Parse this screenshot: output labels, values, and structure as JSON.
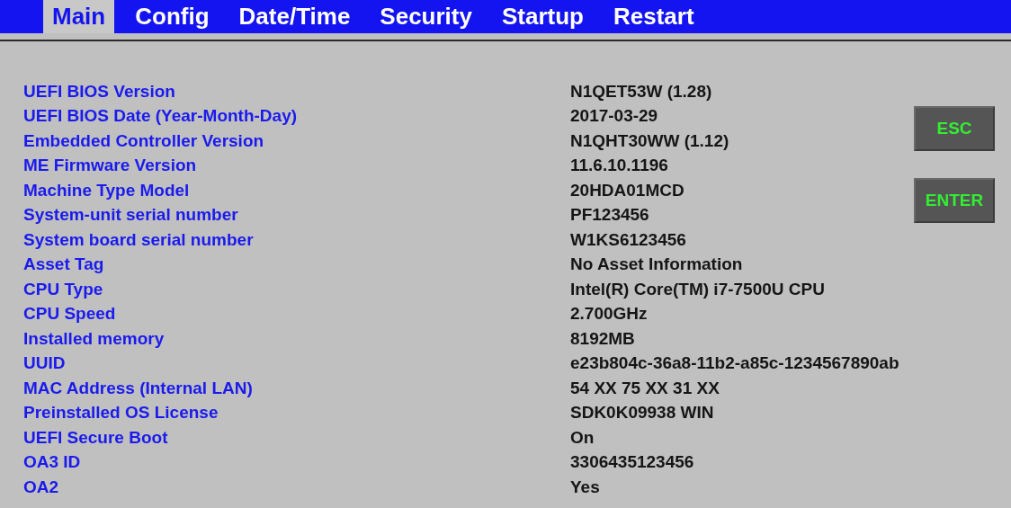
{
  "tabs": [
    {
      "label": "Main",
      "selected": true
    },
    {
      "label": "Config",
      "selected": false
    },
    {
      "label": "Date/Time",
      "selected": false
    },
    {
      "label": "Security",
      "selected": false
    },
    {
      "label": "Startup",
      "selected": false
    },
    {
      "label": "Restart",
      "selected": false
    }
  ],
  "info": [
    {
      "label": "UEFI BIOS Version",
      "value": "N1QET53W (1.28)"
    },
    {
      "label": "UEFI BIOS Date (Year-Month-Day)",
      "value": "2017-03-29"
    },
    {
      "label": "Embedded Controller Version",
      "value": "N1QHT30WW (1.12)"
    },
    {
      "label": "ME Firmware Version",
      "value": "11.6.10.1196"
    },
    {
      "label": "Machine Type Model",
      "value": "20HDA01MCD"
    },
    {
      "label": "System-unit serial number",
      "value": "PF123456"
    },
    {
      "label": "System board serial number",
      "value": "W1KS6123456"
    },
    {
      "label": "Asset Tag",
      "value": "No Asset Information"
    },
    {
      "label": "CPU Type",
      "value": "Intel(R) Core(TM) i7-7500U CPU"
    },
    {
      "label": "CPU Speed",
      "value": "2.700GHz"
    },
    {
      "label": "Installed memory",
      "value": "8192MB"
    },
    {
      "label": "UUID",
      "value": "e23b804c-36a8-11b2-a85c-1234567890ab"
    },
    {
      "label": "MAC Address (Internal LAN)",
      "value": "54 XX 75 XX 31 XX"
    },
    {
      "label": "Preinstalled OS License",
      "value": "SDK0K09938 WIN"
    },
    {
      "label": "UEFI Secure Boot",
      "value": "On"
    },
    {
      "label": "OA3 ID",
      "value": "3306435123456"
    },
    {
      "label": "OA2",
      "value": "Yes"
    }
  ],
  "keys": [
    "ESC",
    "ENTER"
  ]
}
